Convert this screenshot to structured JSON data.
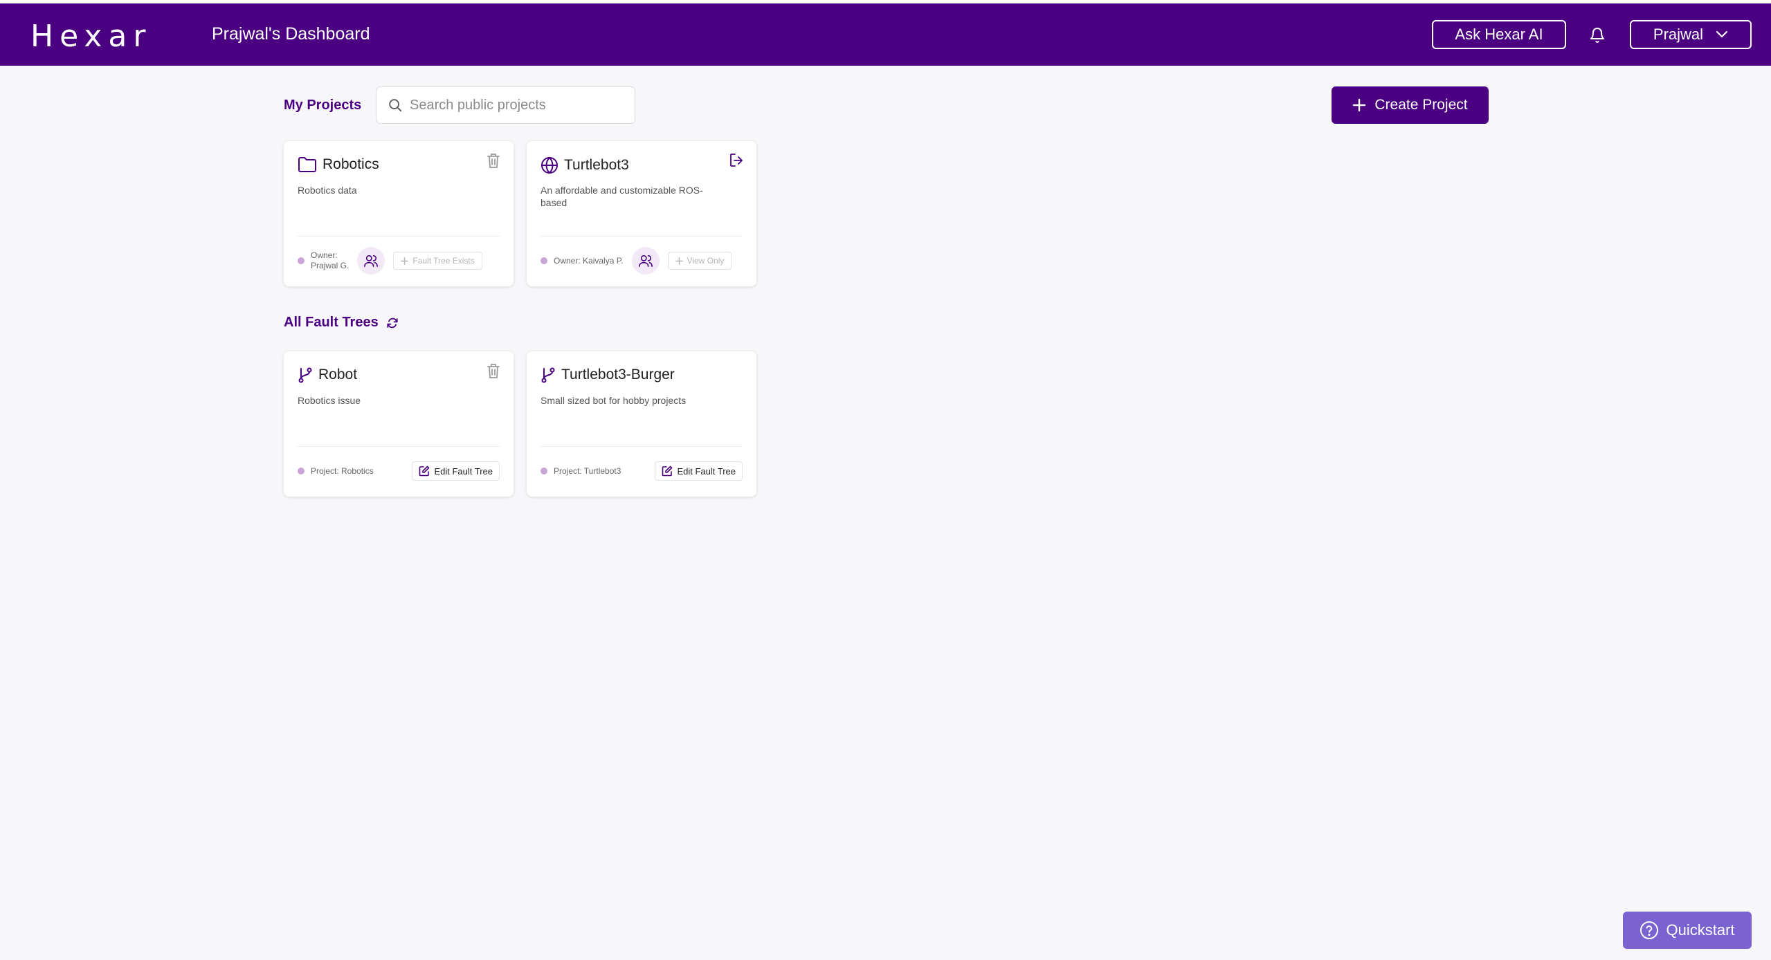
{
  "app": {
    "logo": "Hexar",
    "dashboard_title": "Prajwal's Dashboard",
    "ask_label": "Ask Hexar AI",
    "user_name": "Prajwal",
    "brand_color": "#4b0082"
  },
  "projects": {
    "title": "My Projects",
    "search_placeholder": "Search public projects",
    "create_label": "Create Project",
    "items": [
      {
        "name": "Robotics",
        "description": "Robotics data",
        "icon": "folder-icon",
        "corner_icon": "trash-icon",
        "owner_label": "Owner:",
        "owner_name": "Prajwal G.",
        "action_label": "Fault Tree Exists"
      },
      {
        "name": "Turtlebot3",
        "description": "An affordable and customizable ROS-based",
        "icon": "globe-icon",
        "corner_icon": "leave-icon",
        "owner_text": "Owner: Kaivalya P.",
        "action_label": "View Only"
      }
    ]
  },
  "fault_trees": {
    "title": "All Fault Trees",
    "items": [
      {
        "name": "Robot",
        "description": "Robotics issue",
        "project": "Project: Robotics",
        "edit_label": "Edit Fault Tree"
      },
      {
        "name": "Turtlebot3-Burger",
        "description": "Small sized bot for hobby projects",
        "project": "Project: Turtlebot3",
        "edit_label": "Edit Fault Tree"
      }
    ]
  },
  "quickstart_label": "Quickstart"
}
